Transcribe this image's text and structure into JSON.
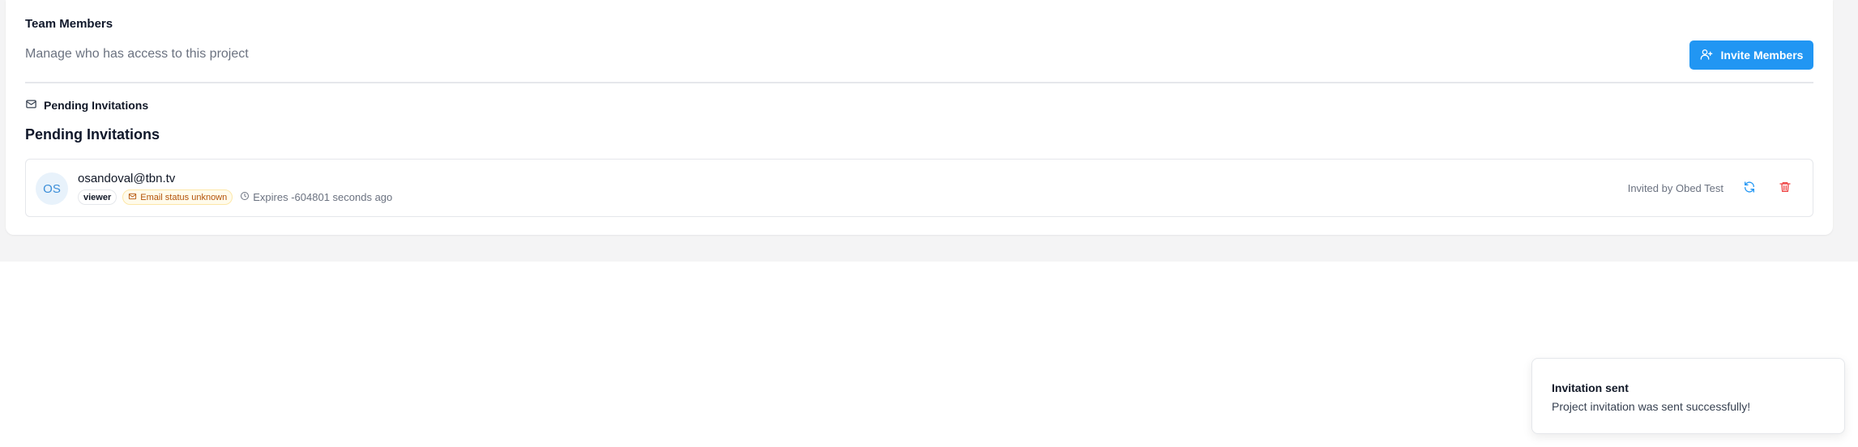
{
  "team": {
    "title": "Team Members",
    "description": "Manage who has access to this project",
    "invite_button_label": "Invite Members",
    "invite_button_icon": "user-plus-icon"
  },
  "pending": {
    "tab_label": "Pending Invitations",
    "tab_icon": "mail-icon",
    "heading": "Pending Invitations",
    "invitations": [
      {
        "initials": "OS",
        "email": "osandoval@tbn.tv",
        "role": "viewer",
        "email_status": "Email status unknown",
        "expires": "Expires -604801 seconds ago",
        "invited_by": "Invited by Obed Test",
        "actions": [
          "refresh-icon",
          "trash-icon"
        ]
      }
    ]
  },
  "toast": {
    "title": "Invitation sent",
    "message": "Project invitation was sent successfully!"
  },
  "colors": {
    "primary": "#2196f3",
    "danger": "#ef4444",
    "warning_text": "#b45309",
    "warning_bg": "#fffbeb",
    "page_bg": "#f4f4f5"
  }
}
